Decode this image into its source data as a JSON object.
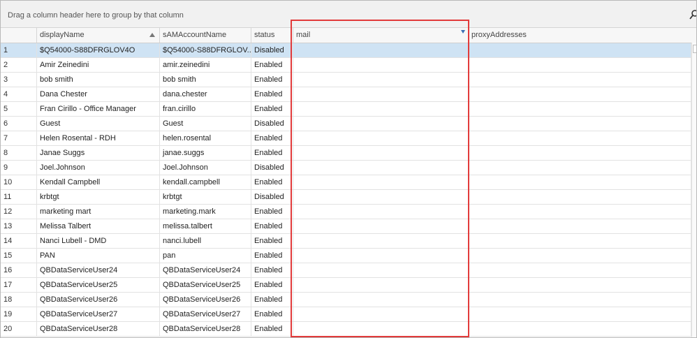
{
  "group_panel": {
    "hint": "Drag a column header here to group by that column",
    "search_icon": "search-icon"
  },
  "columns": [
    {
      "key": "rownum",
      "label": ""
    },
    {
      "key": "displayName",
      "label": "displayName"
    },
    {
      "key": "sAMAccountName",
      "label": "sAMAccountName"
    },
    {
      "key": "status",
      "label": "status"
    },
    {
      "key": "mail",
      "label": "mail"
    },
    {
      "key": "proxyAddresses",
      "label": "proxyAddresses"
    }
  ],
  "rows": [
    {
      "n": "1",
      "displayName": "$Q54000-S88DFRGLOV4O",
      "sAMAccountName": "$Q54000-S88DFRGLOV...",
      "status": "Disabled",
      "mail": "",
      "proxyAddresses": ""
    },
    {
      "n": "2",
      "displayName": "Amir Zeinedini",
      "sAMAccountName": "amir.zeinedini",
      "status": "Enabled",
      "mail": "",
      "proxyAddresses": ""
    },
    {
      "n": "3",
      "displayName": "bob smith",
      "sAMAccountName": "bob smith",
      "status": "Enabled",
      "mail": "",
      "proxyAddresses": ""
    },
    {
      "n": "4",
      "displayName": "Dana Chester",
      "sAMAccountName": "dana.chester",
      "status": "Enabled",
      "mail": "",
      "proxyAddresses": ""
    },
    {
      "n": "5",
      "displayName": "Fran Cirillo - Office Manager",
      "sAMAccountName": "fran.cirillo",
      "status": "Enabled",
      "mail": "",
      "proxyAddresses": ""
    },
    {
      "n": "6",
      "displayName": "Guest",
      "sAMAccountName": "Guest",
      "status": "Disabled",
      "mail": "",
      "proxyAddresses": ""
    },
    {
      "n": "7",
      "displayName": "Helen Rosental - RDH",
      "sAMAccountName": "helen.rosental",
      "status": "Enabled",
      "mail": "",
      "proxyAddresses": ""
    },
    {
      "n": "8",
      "displayName": "Janae Suggs",
      "sAMAccountName": "janae.suggs",
      "status": "Enabled",
      "mail": "",
      "proxyAddresses": ""
    },
    {
      "n": "9",
      "displayName": "Joel.Johnson",
      "sAMAccountName": "Joel.Johnson",
      "status": "Disabled",
      "mail": "",
      "proxyAddresses": ""
    },
    {
      "n": "10",
      "displayName": "Kendall Campbell",
      "sAMAccountName": "kendall.campbell",
      "status": "Enabled",
      "mail": "",
      "proxyAddresses": ""
    },
    {
      "n": "11",
      "displayName": "krbtgt",
      "sAMAccountName": "krbtgt",
      "status": "Disabled",
      "mail": "",
      "proxyAddresses": ""
    },
    {
      "n": "12",
      "displayName": "marketing mart",
      "sAMAccountName": "marketing.mark",
      "status": "Enabled",
      "mail": "",
      "proxyAddresses": ""
    },
    {
      "n": "13",
      "displayName": "Melissa Talbert",
      "sAMAccountName": "melissa.talbert",
      "status": "Enabled",
      "mail": "",
      "proxyAddresses": ""
    },
    {
      "n": "14",
      "displayName": "Nanci Lubell - DMD",
      "sAMAccountName": "nanci.lubell",
      "status": "Enabled",
      "mail": "",
      "proxyAddresses": ""
    },
    {
      "n": "15",
      "displayName": "PAN",
      "sAMAccountName": "pan",
      "status": "Enabled",
      "mail": "",
      "proxyAddresses": ""
    },
    {
      "n": "16",
      "displayName": "QBDataServiceUser24",
      "sAMAccountName": "QBDataServiceUser24",
      "status": "Enabled",
      "mail": "",
      "proxyAddresses": ""
    },
    {
      "n": "17",
      "displayName": "QBDataServiceUser25",
      "sAMAccountName": "QBDataServiceUser25",
      "status": "Enabled",
      "mail": "",
      "proxyAddresses": ""
    },
    {
      "n": "18",
      "displayName": "QBDataServiceUser26",
      "sAMAccountName": "QBDataServiceUser26",
      "status": "Enabled",
      "mail": "",
      "proxyAddresses": ""
    },
    {
      "n": "19",
      "displayName": "QBDataServiceUser27",
      "sAMAccountName": "QBDataServiceUser27",
      "status": "Enabled",
      "mail": "",
      "proxyAddresses": ""
    },
    {
      "n": "20",
      "displayName": "QBDataServiceUser28",
      "sAMAccountName": "QBDataServiceUser28",
      "status": "Enabled",
      "mail": "",
      "proxyAddresses": ""
    }
  ],
  "colors": {
    "selected_row": "#cfe3f4",
    "highlight_border": "#e23a3a",
    "filter_icon": "#3c6fb4"
  }
}
